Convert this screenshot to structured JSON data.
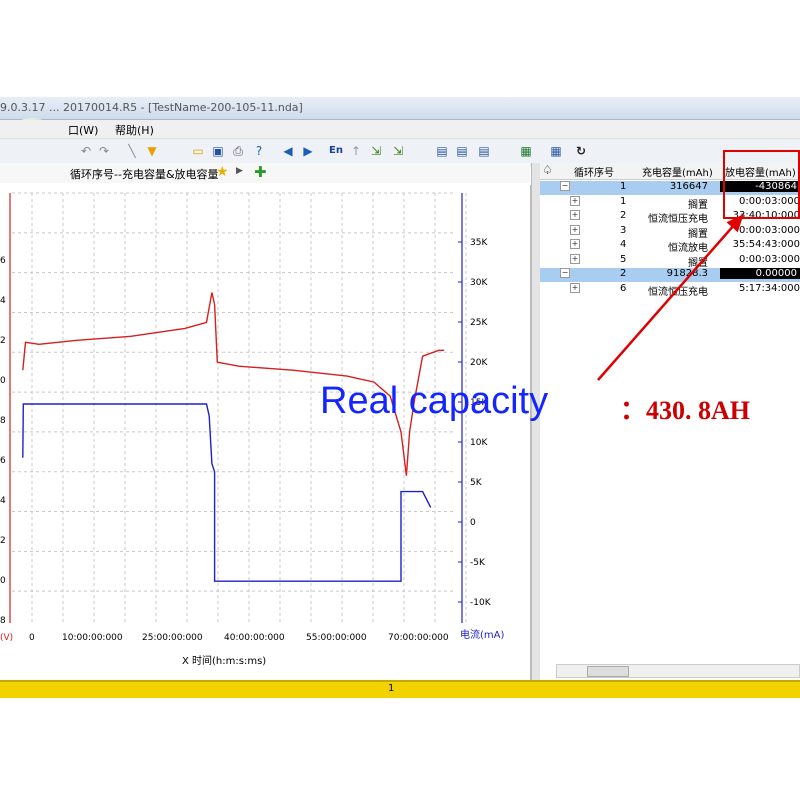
{
  "window": {
    "title": "9.0.3.17 ... 20170014.R5 - [TestName-200-105-11.nda]"
  },
  "menu": {
    "window": "口(W)",
    "help": "帮助(H)"
  },
  "chart_header": {
    "title": "循环序号--充电容量&放电容量"
  },
  "chart_data": {
    "type": "line",
    "xlabel": "X  时间(h:m:s:ms)",
    "x_ticks": [
      "0",
      "10:00:00:000",
      "25:00:00:000",
      "40:00:00:000",
      "55:00:00:000",
      "70:00:00:000"
    ],
    "y_left_label": "(V)",
    "y_left_ticks": [
      "6",
      "4",
      "2",
      "0",
      "8",
      "6",
      "4",
      "2",
      "0",
      "8"
    ],
    "y_right_label": "电流(mA)",
    "y_right_ticks": [
      "35K",
      "30K",
      "25K",
      "20K",
      "15K",
      "10K",
      "5K",
      "0",
      "-5K",
      "-10K"
    ],
    "grid": true,
    "series": [
      {
        "color": "#d42020",
        "points": [
          [
            0,
            2.35
          ],
          [
            0.5,
            3.05
          ],
          [
            3,
            3.0
          ],
          [
            10,
            3.1
          ],
          [
            20,
            3.2
          ],
          [
            30,
            3.4
          ],
          [
            34,
            3.55
          ],
          [
            35,
            4.3
          ],
          [
            35.5,
            4.0
          ],
          [
            36,
            2.55
          ],
          [
            40,
            2.45
          ],
          [
            50,
            2.35
          ],
          [
            60,
            2.2
          ],
          [
            65,
            2.05
          ],
          [
            68,
            1.7
          ],
          [
            70,
            0.8
          ],
          [
            71,
            -0.3
          ],
          [
            71.6,
            0.8
          ],
          [
            72.5,
            1.6
          ],
          [
            74,
            2.7
          ],
          [
            77,
            2.85
          ],
          [
            78,
            2.85
          ]
        ]
      },
      {
        "color": "#2020c8",
        "points": [
          [
            0,
            0.15
          ],
          [
            0.1,
            1.5
          ],
          [
            34,
            1.5
          ],
          [
            34.5,
            1.2
          ],
          [
            35,
            0.0
          ],
          [
            35.5,
            -0.2
          ],
          [
            35.5,
            -2.95
          ],
          [
            70,
            -2.95
          ],
          [
            70,
            -0.7
          ],
          [
            71,
            -0.7
          ],
          [
            74,
            -0.7
          ],
          [
            75.5,
            -1.1
          ]
        ]
      }
    ]
  },
  "grid_table": {
    "headers": [
      "循环序号",
      "充电容量(mAh)",
      "放电容量(mAh)"
    ],
    "rows": [
      {
        "expander": "−",
        "id": "1",
        "name": "",
        "charge": "316647",
        "discharge": "-430864",
        "selected": true
      },
      {
        "expander": "+",
        "id": "1",
        "name": "搁置",
        "charge": "",
        "discharge": "0:00:03:000",
        "selected": false
      },
      {
        "expander": "+",
        "id": "2",
        "name": "恒流恒压充电",
        "charge": "",
        "discharge": "33:40:10:000",
        "selected": false
      },
      {
        "expander": "+",
        "id": "3",
        "name": "搁置",
        "charge": "",
        "discharge": "0:00:03:000",
        "selected": false
      },
      {
        "expander": "+",
        "id": "4",
        "name": "恒流放电",
        "charge": "",
        "discharge": "35:54:43:000",
        "selected": false
      },
      {
        "expander": "+",
        "id": "5",
        "name": "搁置",
        "charge": "",
        "discharge": "0:00:03:000",
        "selected": false
      },
      {
        "expander": "−",
        "id": "2",
        "name": "",
        "charge": "91828.3",
        "discharge": "0.00000",
        "selected": true
      },
      {
        "expander": "+",
        "id": "6",
        "name": "恒流恒压充电",
        "charge": "",
        "discharge": "5:17:34:000",
        "selected": false
      }
    ]
  },
  "status": {
    "page": "1"
  },
  "annotation": {
    "label": "Real capacity",
    "value": "：430. 8AH"
  },
  "colors": {
    "voltage": "#d42020",
    "current": "#2020c8",
    "status": "#f2d300",
    "annotation_label": "#1525ff",
    "annotation_value": "#cc0000"
  }
}
